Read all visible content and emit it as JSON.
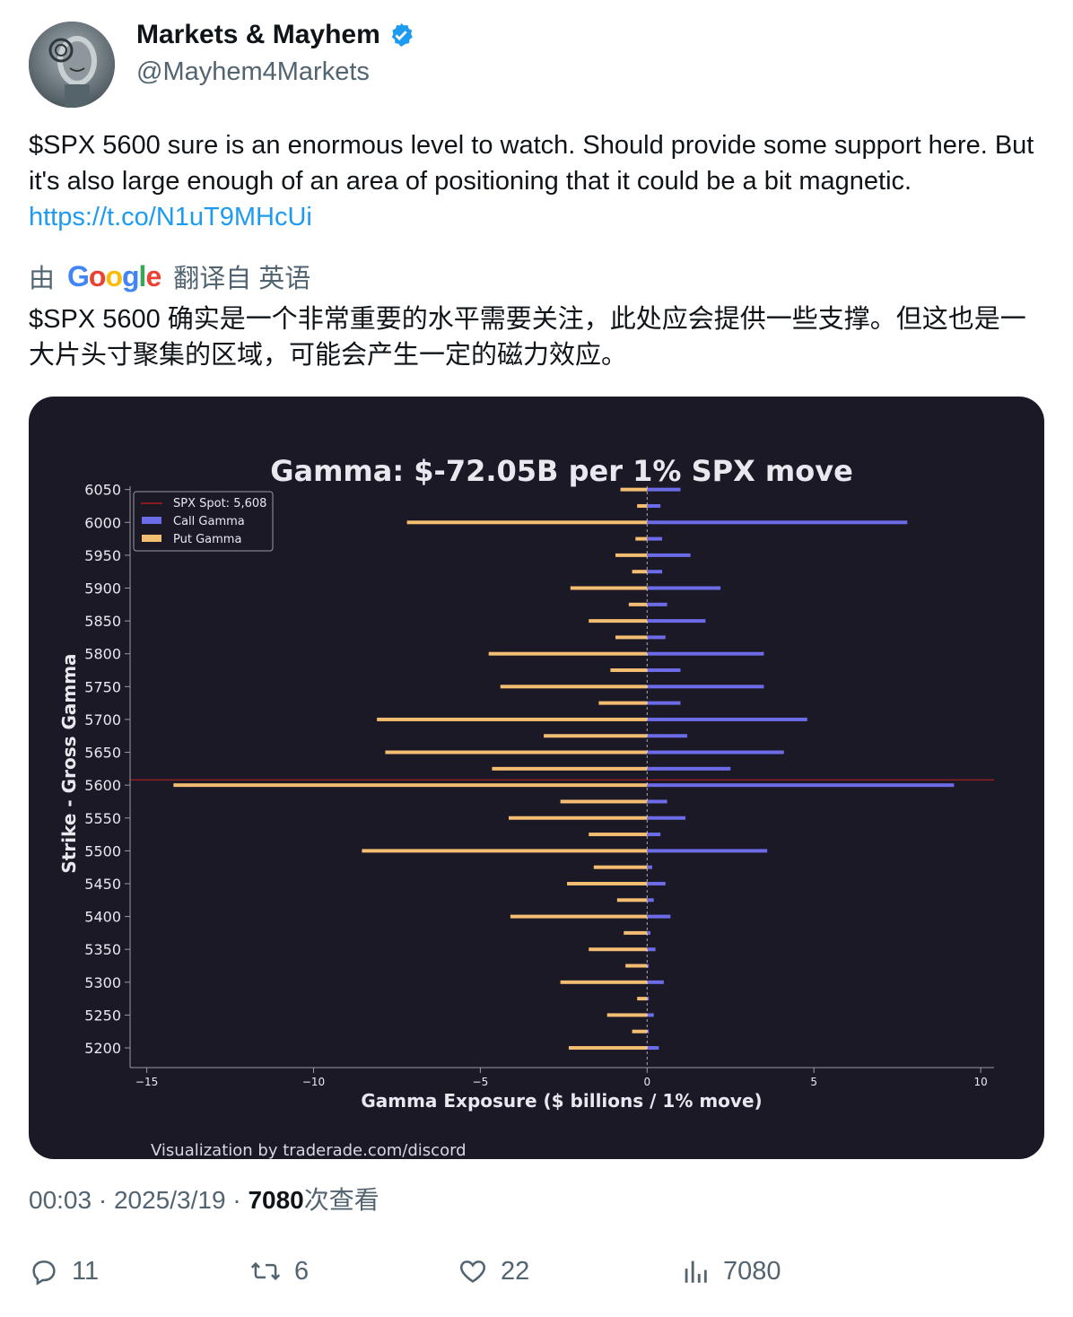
{
  "author": {
    "name": "Markets & Mayhem",
    "handle": "@Mayhem4Markets"
  },
  "tweet": {
    "text": "$SPX 5600 sure is an enormous level to watch. Should provide some support here. But it's also large enough of an area of positioning that it could be a bit magnetic.",
    "link": "https://t.co/N1uT9MHcUi"
  },
  "translation": {
    "prefix": "由",
    "provider": "Google",
    "suffix": "翻译自 英语",
    "text": "$SPX 5600 确实是一个非常重要的水平需要关注，此处应会提供一些支撑。但这也是一大片头寸聚集的区域，可能会产生一定的磁力效应。"
  },
  "chart_data": {
    "type": "bar",
    "orientation": "horizontal",
    "title": "Gamma: $-72.05B per 1% SPX move",
    "xlabel": "Gamma Exposure ($ billions / 1% move)",
    "ylabel": "Strike - Gross Gamma",
    "xlim": [
      -15.5,
      10.4
    ],
    "ylim": [
      5170,
      6055
    ],
    "x_ticks": [
      -15,
      -10,
      -5,
      0,
      5,
      10
    ],
    "x_tick_labels": [
      "−15",
      "−10",
      "−5",
      "0",
      "5",
      "10"
    ],
    "y_ticks": [
      5200,
      5250,
      5300,
      5350,
      5400,
      5450,
      5500,
      5550,
      5600,
      5650,
      5700,
      5750,
      5800,
      5850,
      5900,
      5950,
      6000,
      6050
    ],
    "spot": 5608,
    "legend": [
      "SPX Spot: 5,608",
      "Call Gamma",
      "Put Gamma"
    ],
    "legend_position": "upper-left",
    "colors": {
      "call": "#6c6ce8",
      "put": "#f3bd72",
      "spot": "#c81e1e"
    },
    "series": [
      {
        "name": "Call Gamma",
        "strikes": [
          6050,
          6025,
          6000,
          5975,
          5950,
          5925,
          5900,
          5875,
          5850,
          5825,
          5800,
          5775,
          5750,
          5725,
          5700,
          5675,
          5650,
          5625,
          5600,
          5575,
          5550,
          5525,
          5500,
          5475,
          5450,
          5425,
          5400,
          5375,
          5350,
          5325,
          5300,
          5275,
          5250,
          5225,
          5200
        ],
        "values": [
          1.0,
          0.4,
          7.8,
          0.45,
          1.3,
          0.45,
          2.2,
          0.6,
          1.75,
          0.55,
          3.5,
          1.0,
          3.5,
          1.0,
          4.8,
          1.2,
          4.1,
          2.5,
          9.2,
          0.6,
          1.15,
          0.4,
          3.6,
          0.15,
          0.55,
          0.2,
          0.7,
          0.1,
          0.25,
          0.05,
          0.5,
          0.05,
          0.2,
          0.05,
          0.35
        ]
      },
      {
        "name": "Put Gamma",
        "strikes": [
          6050,
          6025,
          6000,
          5975,
          5950,
          5925,
          5900,
          5875,
          5850,
          5825,
          5800,
          5775,
          5750,
          5725,
          5700,
          5675,
          5650,
          5625,
          5600,
          5575,
          5550,
          5525,
          5500,
          5475,
          5450,
          5425,
          5400,
          5375,
          5350,
          5325,
          5300,
          5275,
          5250,
          5225,
          5200
        ],
        "values": [
          -0.8,
          -0.3,
          -7.2,
          -0.35,
          -0.95,
          -0.45,
          -2.3,
          -0.55,
          -1.75,
          -0.95,
          -4.75,
          -1.1,
          -4.4,
          -1.45,
          -8.1,
          -3.1,
          -7.85,
          -4.65,
          -14.2,
          -2.6,
          -4.15,
          -1.75,
          -8.55,
          -1.6,
          -2.4,
          -0.9,
          -4.1,
          -0.7,
          -1.75,
          -0.65,
          -2.6,
          -0.3,
          -1.2,
          -0.45,
          -2.35
        ]
      }
    ],
    "credit": "Visualization by traderade.com/discord"
  },
  "meta": {
    "time": "00:03",
    "separator": "·",
    "date": "2025/3/19",
    "views": "7080",
    "views_suffix": "次查看"
  },
  "actions": {
    "replies": "11",
    "retweets": "6",
    "likes": "22",
    "views": "7080"
  }
}
